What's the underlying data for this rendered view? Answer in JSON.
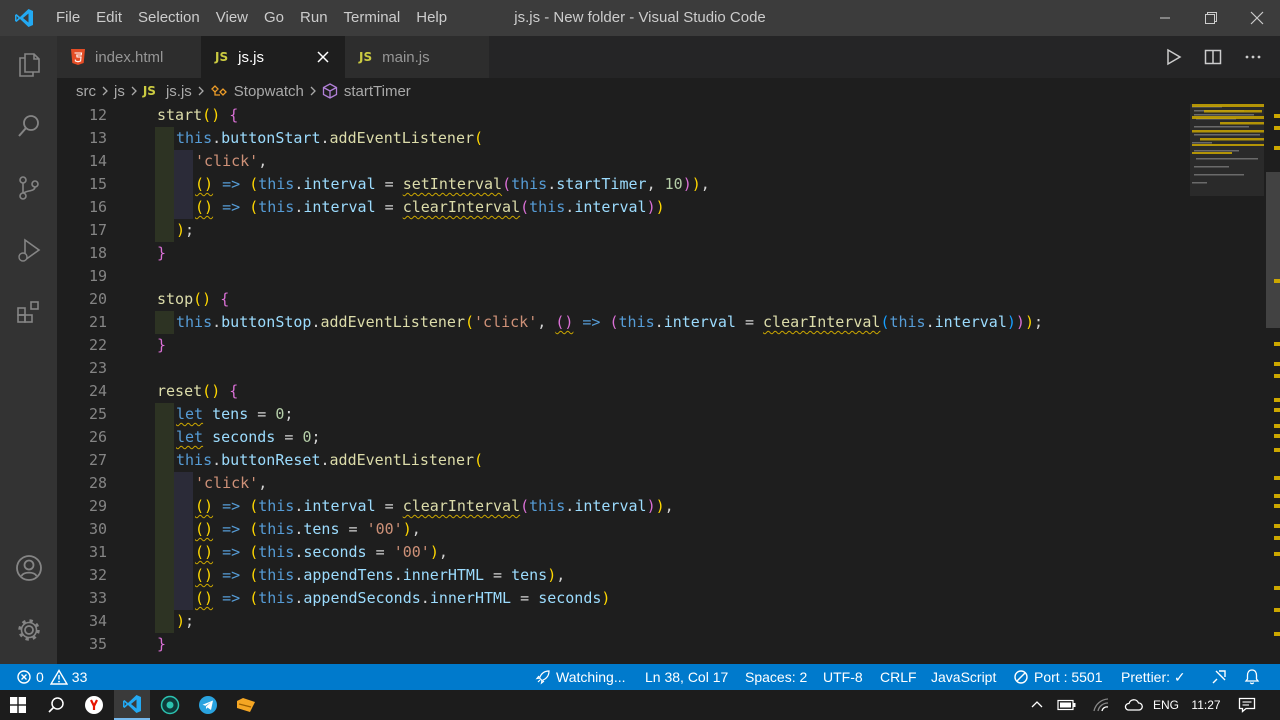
{
  "window": {
    "title": "js.js - New folder - Visual Studio Code",
    "menu": [
      "File",
      "Edit",
      "Selection",
      "View",
      "Go",
      "Run",
      "Terminal",
      "Help"
    ]
  },
  "tabs": [
    {
      "label": "index.html",
      "icon": "html5-icon",
      "active": false
    },
    {
      "label": "js.js",
      "icon": "js-icon",
      "badge": "JS",
      "active": true
    },
    {
      "label": "main.js",
      "icon": "js-icon",
      "badge": "JS",
      "active": false
    }
  ],
  "breadcrumb": {
    "parts": [
      "src",
      "js"
    ],
    "file_badge": "JS",
    "file": "js.js",
    "class_name": "Stopwatch",
    "method": "startTimer"
  },
  "code": {
    "lines": [
      {
        "n": "12",
        "text": "start() {"
      },
      {
        "n": "13",
        "text": "this.buttonStart.addEventListener("
      },
      {
        "n": "14",
        "text": "'click',"
      },
      {
        "n": "15",
        "text": "() => (this.interval = setInterval(this.startTimer, 10)),"
      },
      {
        "n": "16",
        "text": "() => (this.interval = clearInterval(this.interval))"
      },
      {
        "n": "17",
        "text": ");"
      },
      {
        "n": "18",
        "text": "}"
      },
      {
        "n": "19",
        "text": ""
      },
      {
        "n": "20",
        "text": "stop() {"
      },
      {
        "n": "21",
        "text": "this.buttonStop.addEventListener('click', () => (this.interval = clearInterval(this.interval)));"
      },
      {
        "n": "22",
        "text": "}"
      },
      {
        "n": "23",
        "text": ""
      },
      {
        "n": "24",
        "text": "reset() {"
      },
      {
        "n": "25",
        "text": "let tens = 0;"
      },
      {
        "n": "26",
        "text": "let seconds = 0;"
      },
      {
        "n": "27",
        "text": "this.buttonReset.addEventListener("
      },
      {
        "n": "28",
        "text": "'click',"
      },
      {
        "n": "29",
        "text": "() => (this.interval = clearInterval(this.interval)),"
      },
      {
        "n": "30",
        "text": "() => (this.tens = '00'),"
      },
      {
        "n": "31",
        "text": "() => (this.seconds = '00'),"
      },
      {
        "n": "32",
        "text": "() => (this.appendTens.innerHTML = tens),"
      },
      {
        "n": "33",
        "text": "() => (this.appendSeconds.innerHTML = seconds)"
      },
      {
        "n": "34",
        "text": ");"
      },
      {
        "n": "35",
        "text": "}"
      }
    ]
  },
  "statusbar": {
    "errors": "0",
    "warnings": "33",
    "watching": "Watching...",
    "position": "Ln 38, Col 17",
    "spaces": "Spaces: 2",
    "encoding": "UTF-8",
    "eol": "CRLF",
    "language": "JavaScript",
    "port": "Port : 5501",
    "prettier": "Prettier: ✓"
  },
  "taskbar": {
    "language": "ENG",
    "time": "11:27"
  },
  "colors": {
    "accent": "#007acc",
    "titlebar": "#3c3c3c",
    "activitybar": "#333333",
    "editor_bg": "#1e1e1e",
    "warning": "#cca700"
  }
}
